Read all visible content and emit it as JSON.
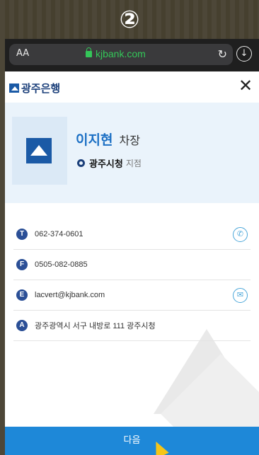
{
  "step_label": "②",
  "browser": {
    "text_size_label": "AA",
    "url": "kjbank.com",
    "reload_icon": "reload-icon",
    "download_icon": "download-icon"
  },
  "header": {
    "logo_text": "광주은행"
  },
  "profile": {
    "name": "이지현",
    "title": "차장",
    "branch": "광주시청",
    "branch_suffix": "지점"
  },
  "contacts": [
    {
      "badge": "T",
      "text": "062-374-0601",
      "action": "call-icon"
    },
    {
      "badge": "F",
      "text": "0505-082-0885",
      "action": null
    },
    {
      "badge": "E",
      "text": "lacvert@kjbank.com",
      "action": "mail-icon"
    },
    {
      "badge": "A",
      "text": "광주광역시 서구 내방로 111 광주시청",
      "action": null
    }
  ],
  "next_button_label": "다음",
  "colors": {
    "primary": "#1e88d8",
    "brand_navy": "#1b3f7a",
    "name_blue": "#1b6fc4",
    "card_bg": "#eaf3fb"
  }
}
